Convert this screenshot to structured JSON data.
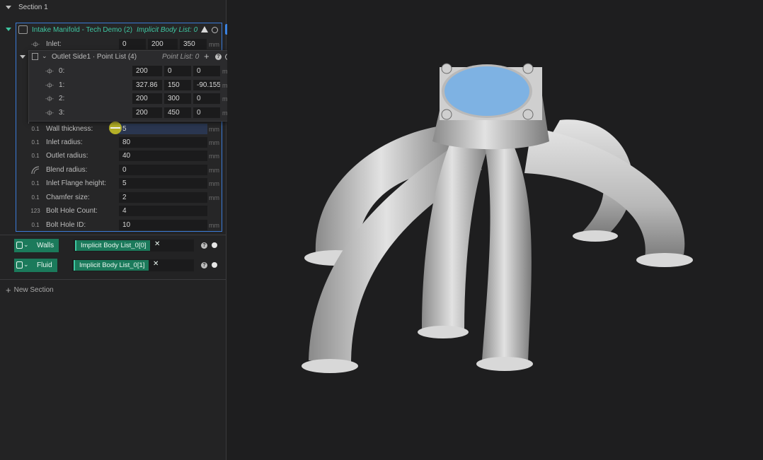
{
  "section": {
    "title": "Section 1"
  },
  "node": {
    "title": "Intake Manifold - Tech Demo (2)",
    "subtitle": "Implicit Body List: 0",
    "inlet": {
      "label": "Inlet:",
      "values": [
        "0",
        "200",
        "350"
      ],
      "unit": "mm"
    },
    "point_list": {
      "title": "Outlet Side1 · Point List (4)",
      "subtitle": "Point List: 0",
      "points": [
        {
          "label": "0:",
          "values": [
            "200",
            "0",
            "0"
          ],
          "unit": "mm"
        },
        {
          "label": "1:",
          "values": [
            "327.86",
            "150",
            "-90.155"
          ],
          "unit": "mm"
        },
        {
          "label": "2:",
          "values": [
            "200",
            "300",
            "0"
          ],
          "unit": "mm"
        },
        {
          "label": "3:",
          "values": [
            "200",
            "450",
            "0"
          ],
          "unit": "mm"
        }
      ]
    },
    "params": [
      {
        "label": "Wall thickness:",
        "value": "5",
        "unit": "mm",
        "icon": "0.1"
      },
      {
        "label": "Inlet radius:",
        "value": "80",
        "unit": "mm",
        "icon": "0.1"
      },
      {
        "label": "Outlet radius:",
        "value": "40",
        "unit": "mm",
        "icon": "0.1"
      },
      {
        "label": "Blend radius:",
        "value": "0",
        "unit": "mm",
        "icon": "arc"
      },
      {
        "label": "Inlet Flange height:",
        "value": "5",
        "unit": "mm",
        "icon": "0.1"
      },
      {
        "label": "Chamfer size:",
        "value": "2",
        "unit": "mm",
        "icon": "0.1"
      },
      {
        "label": "Bolt Hole Count:",
        "value": "4",
        "unit": "",
        "icon": "123"
      },
      {
        "label": "Bolt Hole ID:",
        "value": "10",
        "unit": "mm",
        "icon": "0.1"
      }
    ]
  },
  "outputs": [
    {
      "label": "Walls",
      "chip": "Implicit Body List_0[0]"
    },
    {
      "label": "Fluid",
      "chip": "Implicit Body List_0[1]"
    }
  ],
  "new_section": {
    "label": "New Section"
  },
  "colors": {
    "accent_teal": "#3ec6a1",
    "tag_green": "#1b7a5b",
    "selection_blue": "#3b7bd8",
    "part_gray": "#cfcfcf",
    "inlet_face": "#7eb2e3"
  }
}
